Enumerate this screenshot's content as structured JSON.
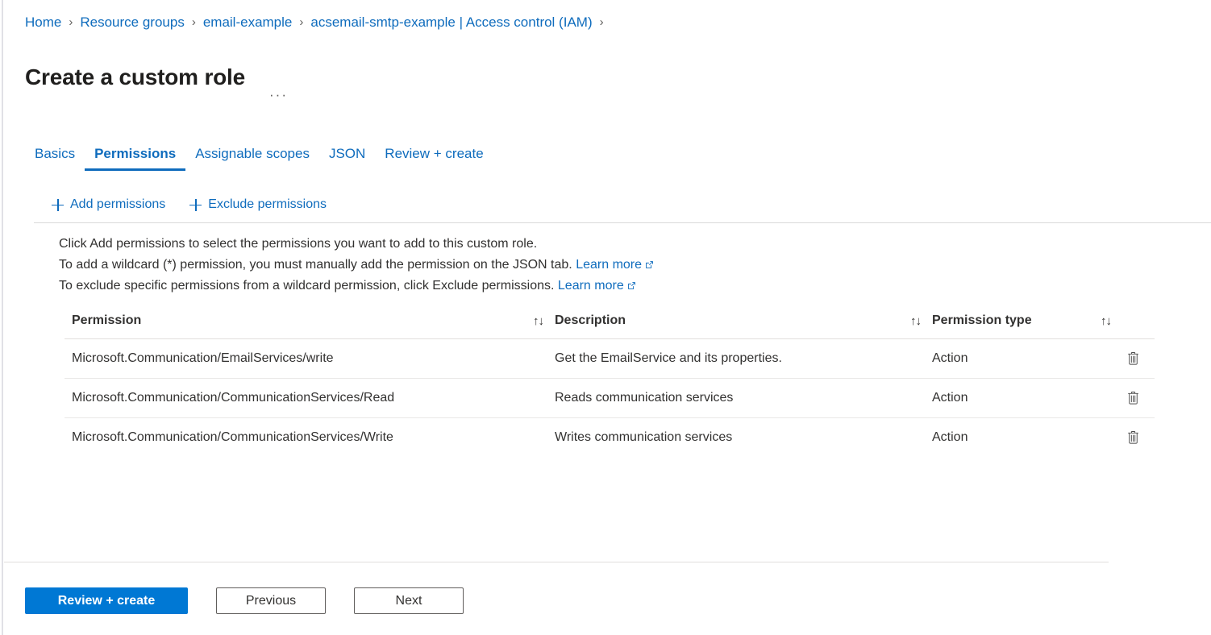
{
  "breadcrumb": {
    "separator": "›",
    "items": [
      {
        "label": "Home"
      },
      {
        "label": "Resource groups"
      },
      {
        "label": "email-example"
      },
      {
        "label": "acsemail-smtp-example | Access control (IAM)"
      }
    ],
    "trailing_separator": "›"
  },
  "header": {
    "title": "Create a custom role",
    "ellipsis": "···"
  },
  "tabs": [
    {
      "label": "Basics",
      "active": false
    },
    {
      "label": "Permissions",
      "active": true
    },
    {
      "label": "Assignable scopes",
      "active": false
    },
    {
      "label": "JSON",
      "active": false
    },
    {
      "label": "Review + create",
      "active": false
    }
  ],
  "commandbar": {
    "add_permissions": "Add permissions",
    "exclude_permissions": "Exclude permissions"
  },
  "instructions": {
    "line1": "Click Add permissions to select the permissions you want to add to this custom role.",
    "line2_text": "To add a wildcard (*) permission, you must manually add the permission on the JSON tab.",
    "line2_link": "Learn more",
    "line3_text": "To exclude specific permissions from a wildcard permission, click Exclude permissions.",
    "line3_link": "Learn more"
  },
  "table": {
    "columns": [
      {
        "label": "Permission",
        "sort": "↑↓"
      },
      {
        "label": "Description",
        "sort": "↑↓"
      },
      {
        "label": "Permission type",
        "sort": "↑↓"
      }
    ],
    "rows": [
      {
        "permission": "Microsoft.Communication/EmailServices/write",
        "description": "Get the EmailService and its properties.",
        "type": "Action"
      },
      {
        "permission": "Microsoft.Communication/CommunicationServices/Read",
        "description": "Reads communication services",
        "type": "Action"
      },
      {
        "permission": "Microsoft.Communication/CommunicationServices/Write",
        "description": "Writes communication services",
        "type": "Action"
      }
    ]
  },
  "footer": {
    "review_create": "Review + create",
    "previous": "Previous",
    "next": "Next"
  },
  "colors": {
    "link": "#0f6cbd",
    "primary_button": "#0078d4",
    "text": "#323130",
    "border": "#e1dfdd"
  }
}
